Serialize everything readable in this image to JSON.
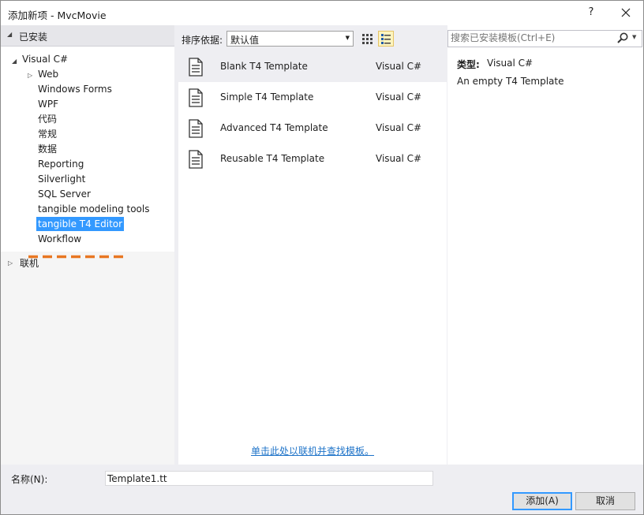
{
  "window": {
    "title": "添加新项 - MvcMovie",
    "help_label": "?"
  },
  "left_panel": {
    "installed_label": "已安装",
    "tree": {
      "root": "Visual C#",
      "children": [
        "Web",
        "Windows Forms",
        "WPF",
        "代码",
        "常规",
        "数据",
        "Reporting",
        "Silverlight",
        "SQL Server",
        "tangible modeling tools",
        "tangible T4 Editor",
        "Workflow"
      ],
      "selected": "tangible T4 Editor"
    },
    "online_label": "联机"
  },
  "toolbar": {
    "sort_label": "排序依据:",
    "sort_value": "默认值"
  },
  "templates": [
    {
      "name": "Blank T4 Template",
      "lang": "Visual C#"
    },
    {
      "name": "Simple T4 Template",
      "lang": "Visual C#"
    },
    {
      "name": "Advanced T4 Template",
      "lang": "Visual C#"
    },
    {
      "name": "Reusable T4 Template",
      "lang": "Visual C#"
    }
  ],
  "online_link": "单击此处以联机并查找模板。",
  "search": {
    "placeholder": "搜索已安装模板(Ctrl+E)"
  },
  "details": {
    "type_label": "类型:",
    "type_value": "Visual C#",
    "description": "An empty T4 Template"
  },
  "footer": {
    "name_label": "名称(N):",
    "name_value": "Template1.tt",
    "add_button": "添加(A)",
    "cancel_button": "取消"
  },
  "colors": {
    "selection": "#3399ff",
    "annotation": "#e87722",
    "link": "#1e73c8"
  }
}
